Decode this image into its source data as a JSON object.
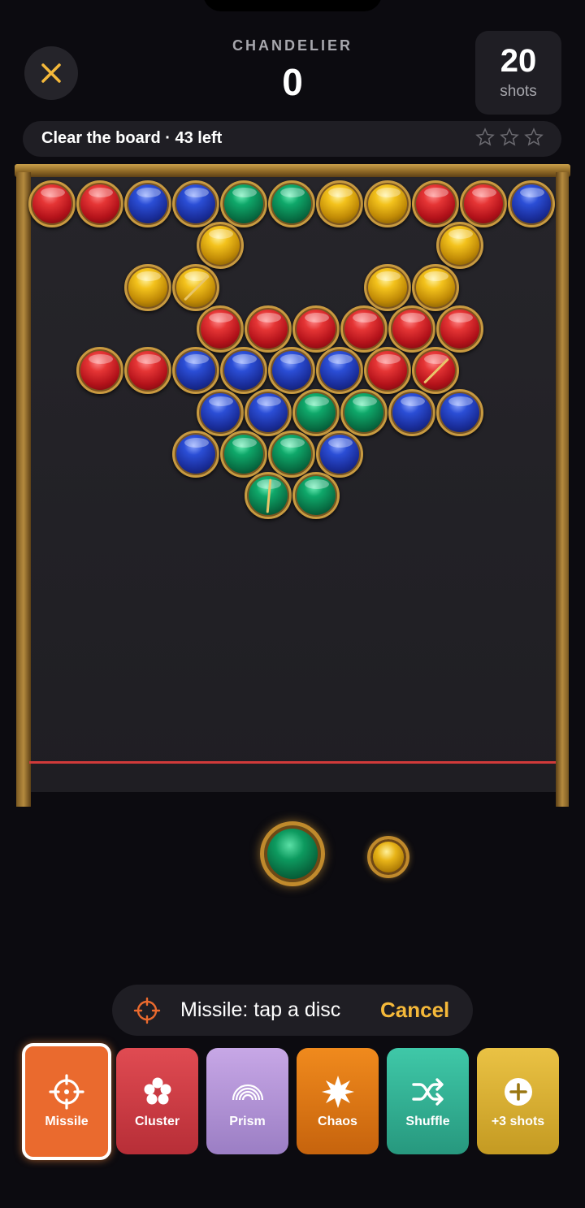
{
  "header": {
    "level_name": "CHANDELIER",
    "score": "0",
    "shots_count": "20",
    "shots_label": "shots"
  },
  "goal": {
    "text": "Clear the board · 43 left",
    "stars_earned": 0,
    "stars_total": 3
  },
  "board": {
    "rows": [
      [
        "red",
        "red",
        "blue",
        "blue",
        "green",
        "green",
        "gold",
        "gold",
        "red",
        "red",
        "blue"
      ],
      [
        null,
        null,
        null,
        "gold",
        null,
        null,
        null,
        null,
        "gold",
        null,
        null
      ],
      [
        null,
        null,
        "gold",
        "gold-cracked",
        null,
        null,
        null,
        "gold",
        "gold",
        null,
        null
      ],
      [
        null,
        null,
        null,
        "red",
        "red",
        "red",
        "red",
        "red",
        "red",
        null,
        null
      ],
      [
        null,
        "red",
        "red",
        "blue",
        "blue",
        "blue",
        "blue",
        "red",
        "red-cracked",
        null,
        null
      ],
      [
        null,
        null,
        null,
        "blue",
        "blue",
        "green",
        "green",
        "blue",
        "blue",
        null,
        null
      ],
      [
        null,
        null,
        null,
        "blue",
        "green",
        "green",
        "blue",
        null,
        null,
        null,
        null
      ],
      [
        null,
        null,
        null,
        null,
        "green-cracked",
        "green",
        null,
        null,
        null,
        null,
        null
      ]
    ]
  },
  "shooter": {
    "current": "green",
    "next": "gold"
  },
  "missile_banner": {
    "text": "Missile: tap a disc",
    "cancel_label": "Cancel"
  },
  "powerups": [
    {
      "label": "Missile",
      "icon": "crosshair-icon",
      "selected": true
    },
    {
      "label": "Cluster",
      "icon": "cluster-icon",
      "selected": false
    },
    {
      "label": "Prism",
      "icon": "rainbow-icon",
      "selected": false
    },
    {
      "label": "Chaos",
      "icon": "burst-icon",
      "selected": false
    },
    {
      "label": "Shuffle",
      "icon": "shuffle-icon",
      "selected": false
    },
    {
      "label": "+3 shots",
      "icon": "plus-icon",
      "selected": false
    }
  ],
  "colors": {
    "red": "#c8202a",
    "blue": "#2440c0",
    "green": "#0c8a55",
    "gold": "#e0aa18",
    "accent": "#f5b93a",
    "danger_line": "#d13a3a"
  }
}
